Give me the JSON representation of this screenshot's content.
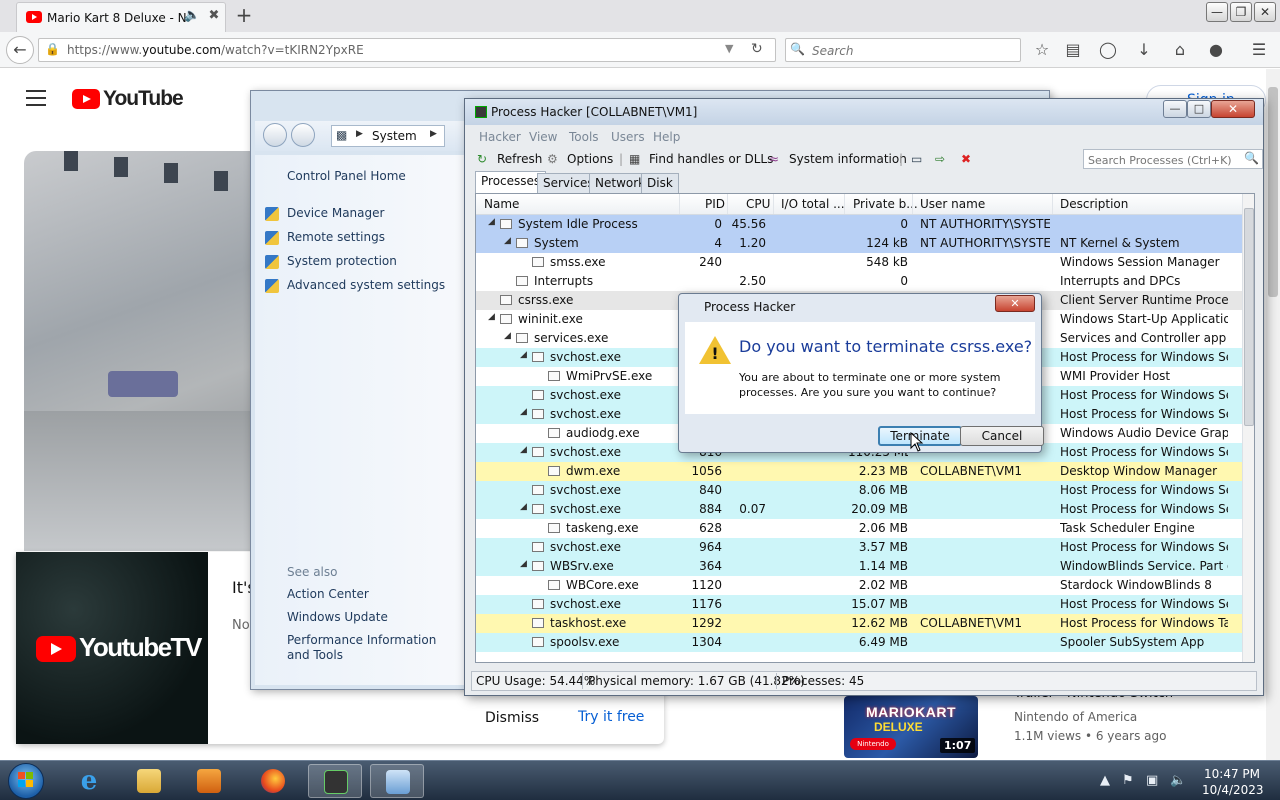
{
  "browser": {
    "tab_title": "Mario Kart 8 Deluxe - N…",
    "url_prefix": "https://www.",
    "url_domain": "youtube.com",
    "url_path": "/watch?v=tKIRN2YpxRE",
    "search_placeholder": "Search"
  },
  "youtube": {
    "logo_text": "YouTube",
    "signin_label": "Sign in",
    "tv_logo_text": "YoutubeTV",
    "promo_heading": "It's",
    "promo_body": "No ca",
    "promo_dismiss": "Dismiss",
    "promo_try": "Try it free",
    "related": {
      "title": "Trailer - Nintendo Switch",
      "thumb_title": "MARIOKART",
      "thumb_subtitle": "DELUXE",
      "thumb_badge": "Nintendo",
      "duration": "1:07",
      "channel": "Nintendo of America",
      "meta": "1.1M views • 6 years ago"
    }
  },
  "control_panel": {
    "address": "System",
    "home_link": "Control Panel Home",
    "links": [
      "Device Manager",
      "Remote settings",
      "System protection",
      "Advanced system settings"
    ],
    "see_also_label": "See also",
    "see_also_links": [
      "Action Center",
      "Windows Update",
      "Performance Information and Tools"
    ]
  },
  "process_hacker": {
    "title": "Process Hacker [COLLABNET\\VM1]",
    "menu": [
      "Hacker",
      "View",
      "Tools",
      "Users",
      "Help"
    ],
    "toolbar": {
      "refresh": "Refresh",
      "options": "Options",
      "find_handles": "Find handles or DLLs",
      "system_info": "System information"
    },
    "search_placeholder": "Search Processes (Ctrl+K)",
    "tabs": [
      "Processes",
      "Services",
      "Network",
      "Disk"
    ],
    "columns": [
      "Name",
      "PID",
      "CPU",
      "I/O total ...",
      "Private b...",
      "User name",
      "Description"
    ],
    "rows": [
      {
        "name": "System Idle Process",
        "indent": 1,
        "tri": true,
        "pid": "0",
        "cpu": "45.56",
        "io": "",
        "priv": "0",
        "user": "NT AUTHORITY\\SYSTEM",
        "desc": "",
        "bg": "#b8d0f5"
      },
      {
        "name": "System",
        "indent": 2,
        "tri": true,
        "pid": "4",
        "cpu": "1.20",
        "io": "",
        "priv": "124 kB",
        "user": "NT AUTHORITY\\SYSTEM",
        "desc": "NT Kernel & System",
        "bg": "#b8d0f5"
      },
      {
        "name": "smss.exe",
        "indent": 3,
        "tri": false,
        "pid": "240",
        "cpu": "",
        "io": "",
        "priv": "548 kB",
        "user": "",
        "desc": "Windows Session Manager",
        "bg": "#ffffff"
      },
      {
        "name": "Interrupts",
        "indent": 2,
        "tri": false,
        "pid": "",
        "cpu": "2.50",
        "io": "",
        "priv": "0",
        "user": "",
        "desc": "Interrupts and DPCs",
        "bg": "#ffffff"
      },
      {
        "name": "csrss.exe",
        "indent": 1,
        "tri": false,
        "pid": "",
        "cpu": "",
        "io": "",
        "priv": "",
        "user": "",
        "desc": "Client Server Runtime Process",
        "bg": "#e6e6e6"
      },
      {
        "name": "wininit.exe",
        "indent": 1,
        "tri": true,
        "pid": "",
        "cpu": "",
        "io": "",
        "priv": "",
        "user": "",
        "desc": "Windows Start-Up Application",
        "bg": "#ffffff"
      },
      {
        "name": "services.exe",
        "indent": 2,
        "tri": true,
        "pid": "",
        "cpu": "",
        "io": "",
        "priv": "",
        "user": "",
        "desc": "Services and Controller app",
        "bg": "#ffffff"
      },
      {
        "name": "svchost.exe",
        "indent": 3,
        "tri": true,
        "pid": "",
        "cpu": "",
        "io": "",
        "priv": "",
        "user": "",
        "desc": "Host Process for Windows Ser...",
        "bg": "#cdf5f9"
      },
      {
        "name": "WmiPrvSE.exe",
        "indent": 4,
        "tri": false,
        "pid": "",
        "cpu": "",
        "io": "",
        "priv": "",
        "user": "",
        "desc": "WMI Provider Host",
        "bg": "#ffffff"
      },
      {
        "name": "svchost.exe",
        "indent": 3,
        "tri": false,
        "pid": "",
        "cpu": "",
        "io": "",
        "priv": "",
        "user": "",
        "desc": "Host Process for Windows Ser...",
        "bg": "#cdf5f9"
      },
      {
        "name": "svchost.exe",
        "indent": 3,
        "tri": true,
        "pid": "",
        "cpu": "",
        "io": "",
        "priv": "",
        "user": "",
        "desc": "Host Process for Windows Ser...",
        "bg": "#cdf5f9"
      },
      {
        "name": "audiodg.exe",
        "indent": 4,
        "tri": false,
        "pid": "",
        "cpu": "",
        "io": "",
        "priv": "",
        "user": "",
        "desc": "Windows Audio Device Graph...",
        "bg": "#ffffff"
      },
      {
        "name": "svchost.exe",
        "indent": 3,
        "tri": true,
        "pid": "816",
        "cpu": "",
        "io": "",
        "priv": "110.25 MB",
        "user": "",
        "desc": "Host Process for Windows Ser...",
        "bg": "#cdf5f9"
      },
      {
        "name": "dwm.exe",
        "indent": 4,
        "tri": false,
        "pid": "1056",
        "cpu": "",
        "io": "",
        "priv": "2.23 MB",
        "user": "COLLABNET\\VM1",
        "desc": "Desktop Window Manager",
        "bg": "#fff8b0"
      },
      {
        "name": "svchost.exe",
        "indent": 3,
        "tri": false,
        "pid": "840",
        "cpu": "",
        "io": "",
        "priv": "8.06 MB",
        "user": "",
        "desc": "Host Process for Windows Ser...",
        "bg": "#cdf5f9"
      },
      {
        "name": "svchost.exe",
        "indent": 3,
        "tri": true,
        "pid": "884",
        "cpu": "0.07",
        "io": "",
        "priv": "20.09 MB",
        "user": "",
        "desc": "Host Process for Windows Ser...",
        "bg": "#cdf5f9"
      },
      {
        "name": "taskeng.exe",
        "indent": 4,
        "tri": false,
        "pid": "628",
        "cpu": "",
        "io": "",
        "priv": "2.06 MB",
        "user": "",
        "desc": "Task Scheduler Engine",
        "bg": "#ffffff"
      },
      {
        "name": "svchost.exe",
        "indent": 3,
        "tri": false,
        "pid": "964",
        "cpu": "",
        "io": "",
        "priv": "3.57 MB",
        "user": "",
        "desc": "Host Process for Windows Ser...",
        "bg": "#cdf5f9"
      },
      {
        "name": "WBSrv.exe",
        "indent": 3,
        "tri": true,
        "pid": "364",
        "cpu": "",
        "io": "",
        "priv": "1.14 MB",
        "user": "",
        "desc": "WindowBlinds Service. Part o...",
        "bg": "#cdf5f9"
      },
      {
        "name": "WBCore.exe",
        "indent": 4,
        "tri": false,
        "pid": "1120",
        "cpu": "",
        "io": "",
        "priv": "2.02 MB",
        "user": "",
        "desc": "Stardock WindowBlinds 8",
        "bg": "#ffffff"
      },
      {
        "name": "svchost.exe",
        "indent": 3,
        "tri": false,
        "pid": "1176",
        "cpu": "",
        "io": "",
        "priv": "15.07 MB",
        "user": "",
        "desc": "Host Process for Windows Ser...",
        "bg": "#cdf5f9"
      },
      {
        "name": "taskhost.exe",
        "indent": 3,
        "tri": false,
        "pid": "1292",
        "cpu": "",
        "io": "",
        "priv": "12.62 MB",
        "user": "COLLABNET\\VM1",
        "desc": "Host Process for Windows Tas...",
        "bg": "#fff8b0"
      },
      {
        "name": "spoolsv.exe",
        "indent": 3,
        "tri": false,
        "pid": "1304",
        "cpu": "",
        "io": "",
        "priv": "6.49 MB",
        "user": "",
        "desc": "Spooler SubSystem App",
        "bg": "#cdf5f9"
      }
    ],
    "status": {
      "cpu": "CPU Usage: 54.44%",
      "memory": "Physical memory: 1.67 GB (41.82%)",
      "processes": "Processes: 45"
    }
  },
  "dialog": {
    "title": "Process Hacker",
    "heading": "Do you want to terminate csrss.exe?",
    "message": "You are about to terminate one or more system processes. Are you sure you want to continue?",
    "terminate_label": "Terminate",
    "cancel_label": "Cancel"
  },
  "taskbar": {
    "time": "10:47 PM",
    "date": "10/4/2023"
  },
  "colors": {
    "youtube_red": "#ff0000",
    "link_blue": "#065fd4",
    "dialog_heading": "#1a3c9a"
  }
}
